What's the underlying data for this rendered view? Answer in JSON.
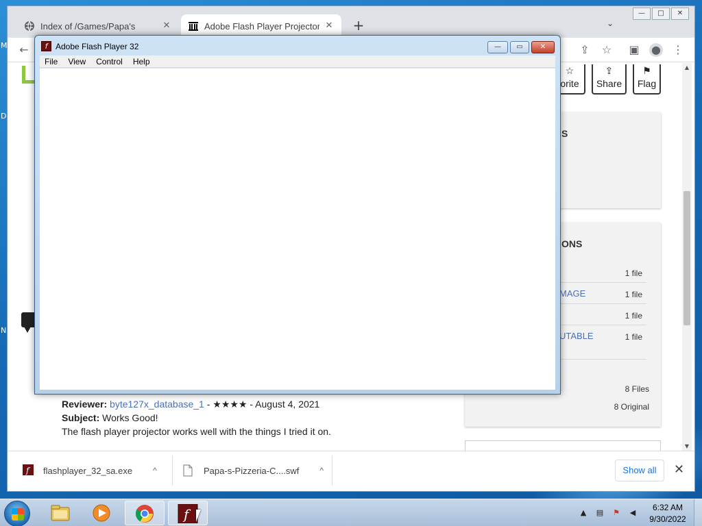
{
  "desktop": {
    "edge_labels": [
      "M",
      "D",
      "N"
    ]
  },
  "chrome": {
    "tabs": [
      {
        "title": "Index of /Games/Papa's",
        "active": false
      },
      {
        "title": "Adobe Flash Player Projector : Ac",
        "active": true
      }
    ],
    "new_tab": "+",
    "tab_search": "⌄",
    "window_buttons": {
      "minimize": "—",
      "maximize": "□",
      "close": "✕"
    }
  },
  "toolbar": {
    "back": "←",
    "share_icon": "⇪",
    "star": "☆",
    "sidebar": "▣",
    "profile": "●",
    "menu": "⋮"
  },
  "page": {
    "actions": [
      {
        "icon": "☆",
        "label": "orite"
      },
      {
        "icon": "⇪",
        "label": "Share"
      },
      {
        "icon": "⚑",
        "label": "Flag"
      }
    ],
    "panel1_title": "S",
    "panel2_title": "ONS",
    "formats": [
      {
        "name": "",
        "count": "1 file"
      },
      {
        "name": "MAGE",
        "count": "1 file"
      },
      {
        "name": "",
        "count": "1 file"
      },
      {
        "name": "UTABLE",
        "count": "1 file"
      }
    ],
    "summary": {
      "files": "8 Files",
      "original": "8 Original"
    },
    "review": {
      "reviewer_label": "Reviewer:",
      "reviewer_name": "byte127x_database_1",
      "reviewer_rest": " - ★★★★ - August 4, 2021",
      "subject_label": "Subject:",
      "subject": "Works Good!",
      "body": "The flash player projector works well with the things I tried it on."
    }
  },
  "downloads": {
    "items": [
      {
        "name": "flashplayer_32_sa.exe",
        "chevron": "^"
      },
      {
        "name": "Papa-s-Pizzeria-C....swf",
        "chevron": "^"
      }
    ],
    "show_all": "Show all",
    "close": "✕"
  },
  "flash_window": {
    "title": "Adobe Flash Player 32",
    "icon_glyph": "f",
    "menu": [
      "File",
      "View",
      "Control",
      "Help"
    ],
    "buttons": {
      "minimize": "—",
      "maximize": "▭",
      "close": "✕"
    }
  },
  "taskbar": {
    "apps": [
      "explorer-icon",
      "media-player-icon",
      "chrome-icon",
      "flash-player-icon"
    ],
    "clock": {
      "time": "6:32 AM",
      "date": "9/30/2022"
    }
  }
}
